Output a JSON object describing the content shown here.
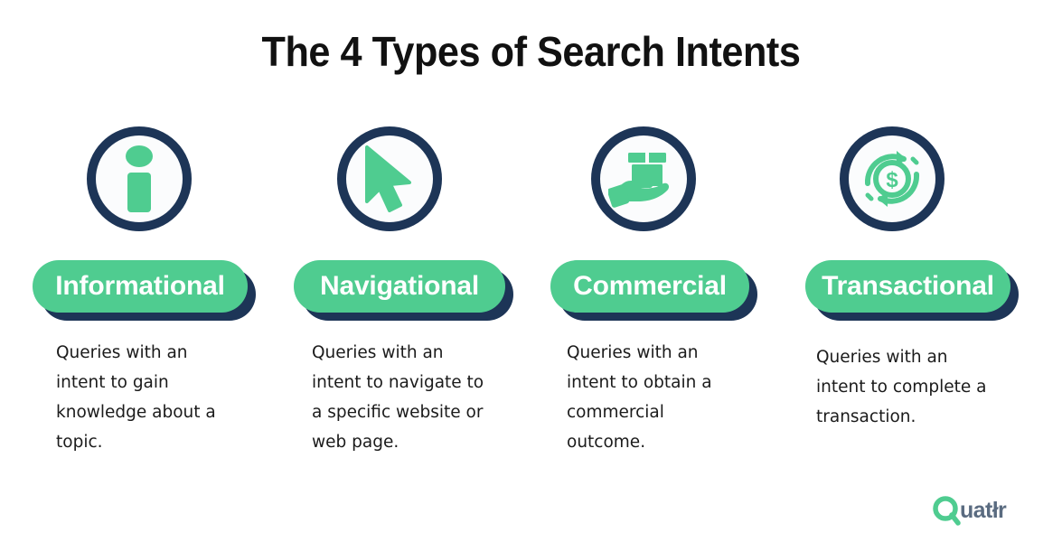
{
  "header": {
    "title": "The 4 Types of Search Intents"
  },
  "colors": {
    "green": "#4fcc90",
    "navy": "#1d3557",
    "text": "#1b1b1b",
    "background": "#ffffff",
    "circle_fill": "#fbfcfd",
    "logo_green": "#4fcc90",
    "logo_dark": "#5a6b80"
  },
  "columns": [
    {
      "icon": "information-icon",
      "label": "Informational",
      "description": "Queries with an intent to gain knowledge about a topic."
    },
    {
      "icon": "cursor-arrow-icon",
      "label": "Navigational",
      "description": "Queries with an intent to navigate to a specific website or web page."
    },
    {
      "icon": "hand-holding-package-icon",
      "label": "Commercial",
      "description": "Queries with an intent to obtain a commercial outcome."
    },
    {
      "icon": "dollar-refresh-icon",
      "label": "Transactional",
      "description": "Queries with an intent to complete a transaction."
    }
  ],
  "logo": {
    "name": "quattr-logo",
    "text_start": "Q",
    "text_rest": "uatłr",
    "full_text": "Quatłr"
  }
}
